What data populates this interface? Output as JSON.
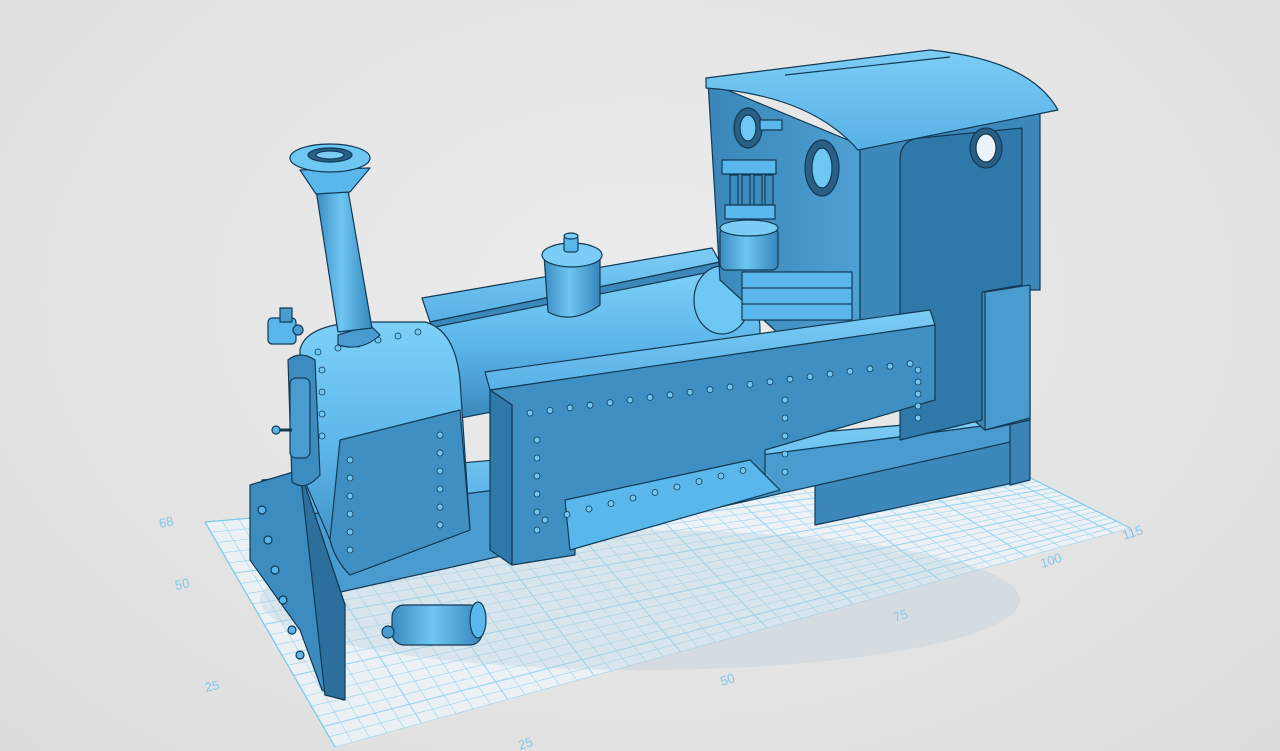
{
  "viewport": {
    "background": "#e4e4e4",
    "model_color": "#5ab7ec",
    "model_shadow_color": "#2f6f9a",
    "grid_color": "#9bd3ef"
  },
  "model": {
    "name_icon": "steam-locomotive-model",
    "parts": [
      "chimney",
      "smokebox",
      "boiler",
      "dome",
      "side-tank",
      "cab",
      "cab-roof",
      "frame",
      "buffer-beam",
      "cylinder",
      "spectacle-windows",
      "whistle-valves"
    ]
  },
  "ruler": {
    "side_labels": [
      "68",
      "50",
      "25"
    ],
    "bottom_labels": [
      "25",
      "50",
      "75",
      "100",
      "115"
    ]
  }
}
